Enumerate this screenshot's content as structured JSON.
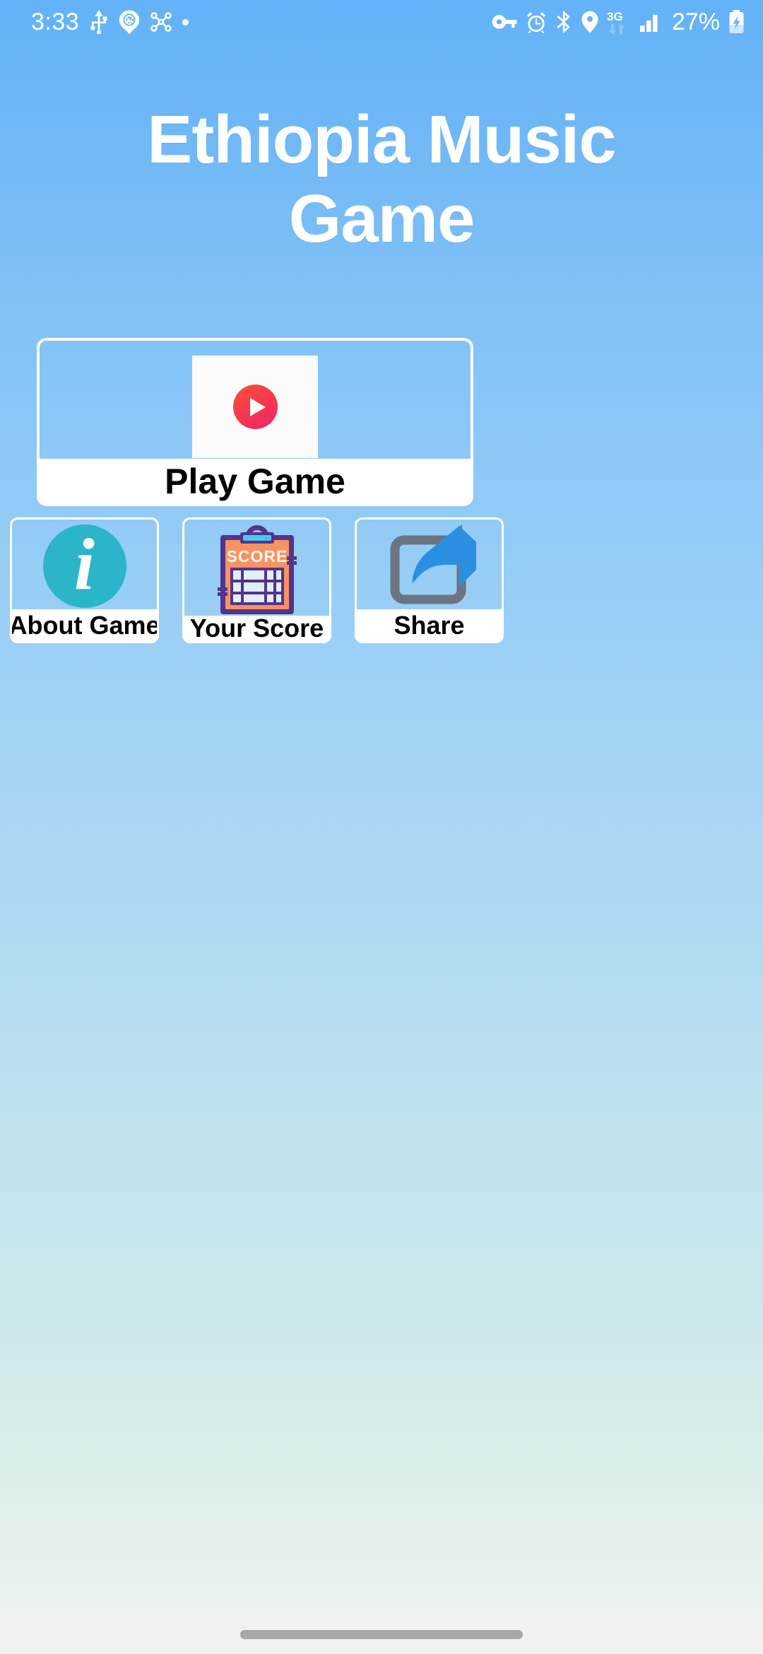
{
  "status_bar": {
    "clock": "3:33",
    "battery_percent": "27%",
    "network_type": "3G",
    "left_icons": [
      "usb-icon",
      "camera-aperture-icon",
      "share-nodes-icon",
      "dot-icon"
    ],
    "right_icons": [
      "vpn-key-icon",
      "alarm-clock-icon",
      "bluetooth-icon",
      "location-pin-icon",
      "3g-data-icon",
      "signal-bars-icon",
      "battery-charging-icon"
    ],
    "text_color": "#ffffff"
  },
  "app": {
    "title_line1": "Ethiopia Music",
    "title_line2": "Game",
    "background_top_color": "#63b2f7",
    "background_bottom_color": "#f2f2f1"
  },
  "play_card": {
    "label": "Play Game",
    "icon": "play-button-icon",
    "accent_color": "#f73a4e",
    "border_color": "#ffffff",
    "thumb_background": "#fbfbfb"
  },
  "tiles": [
    {
      "label": "About Game",
      "icon": "info-circle-icon",
      "icon_glyph": "i",
      "icon_color": "#2bb5c8"
    },
    {
      "label": "Your Score",
      "icon": "score-clipboard-icon",
      "icon_text": "SCORE",
      "icon_color": "#f79362",
      "icon_border_color": "#54338c",
      "icon_clip_color": "#49c6f0"
    },
    {
      "label": "Share",
      "icon": "share-arrow-icon",
      "icon_color": "#2a8fe0",
      "icon_box_color": "#6b7480"
    }
  ],
  "system_nav": {
    "home_indicator": "home-indicator",
    "color": "#a8a8a8"
  }
}
